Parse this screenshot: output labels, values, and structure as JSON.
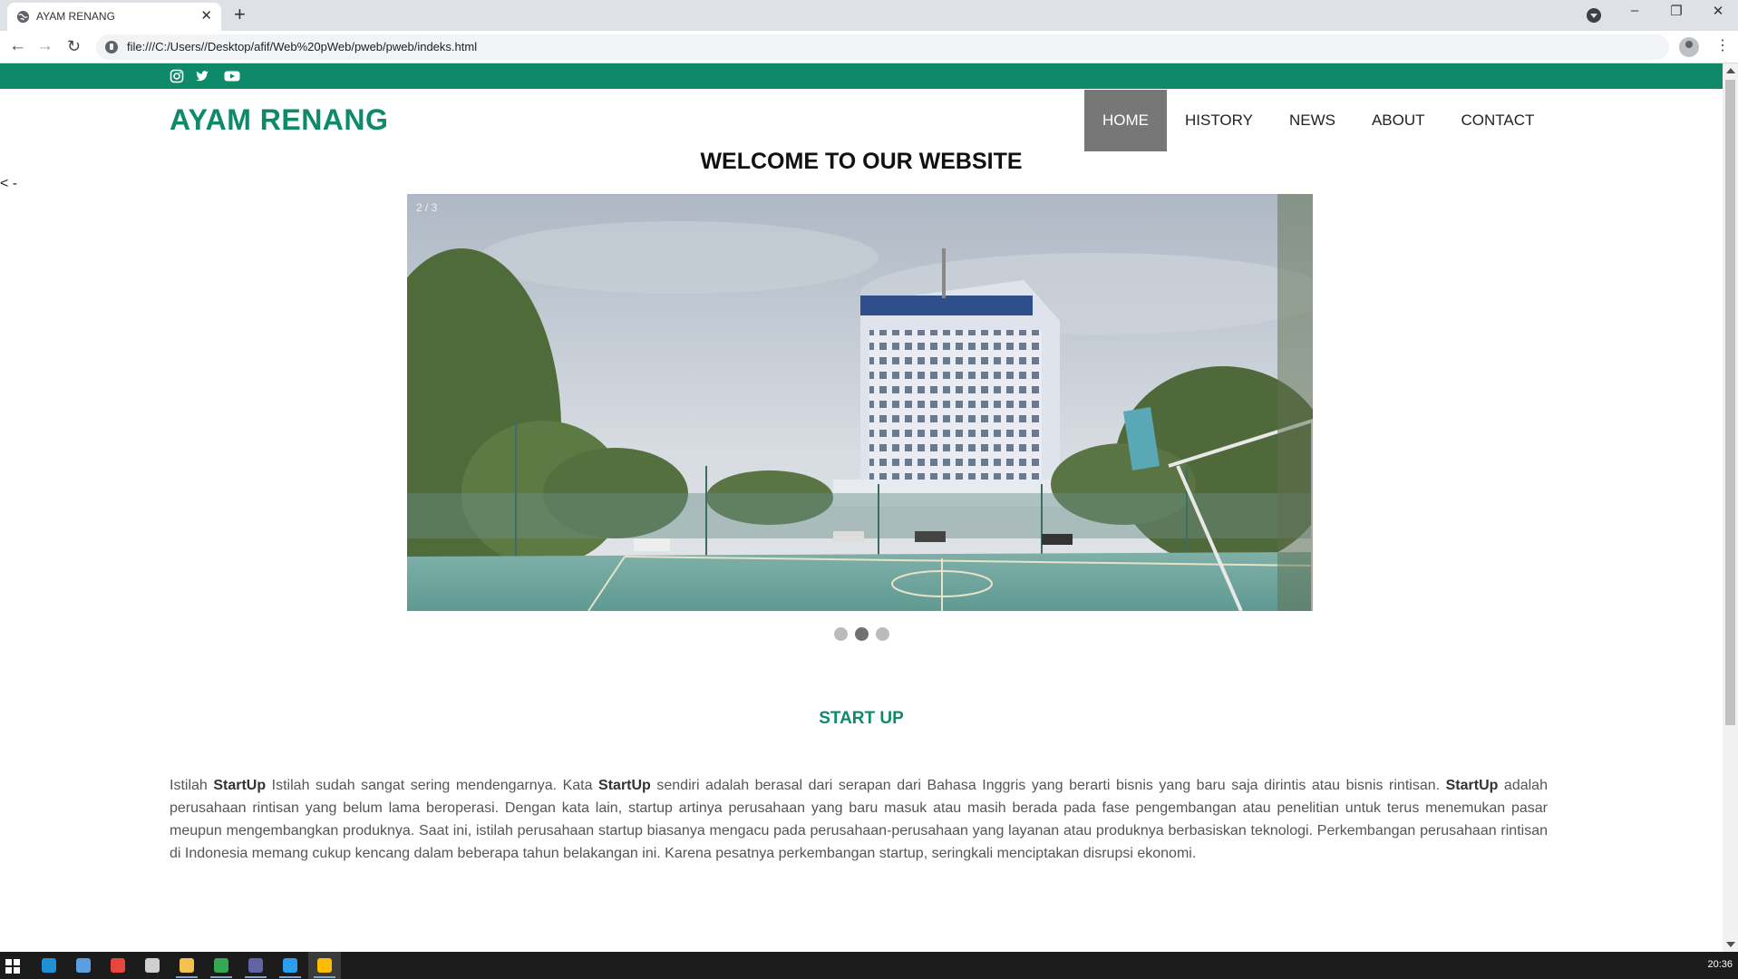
{
  "browser": {
    "tab_title": "AYAM RENANG",
    "url": "file:///C:/Users//Desktop/afif/Web%20pWeb/pweb/pweb/indeks.html",
    "new_tab": "+",
    "close_tab": "✕"
  },
  "site": {
    "social": [
      "instagram-icon",
      "twitter-icon",
      "youtube-icon"
    ],
    "brand": "AYAM RENANG",
    "nav": [
      {
        "label": "HOME",
        "active": true
      },
      {
        "label": "HISTORY",
        "active": false
      },
      {
        "label": "NEWS",
        "active": false
      },
      {
        "label": "ABOUT",
        "active": false
      },
      {
        "label": "CONTACT",
        "active": false
      }
    ],
    "left_arrow": "< -",
    "welcome": "WELCOME TO OUR WEBSITE",
    "slideshow": {
      "counter": "2 / 3",
      "total": 3,
      "current": 2
    },
    "section_title": "START UP",
    "paragraph": [
      {
        "t": "Istilah "
      },
      {
        "t": "StartUp",
        "b": true
      },
      {
        "t": " Istilah sudah sangat sering mendengarnya. Kata "
      },
      {
        "t": "StartUp",
        "b": true
      },
      {
        "t": " sendiri adalah berasal dari serapan dari Bahasa Inggris yang berarti bisnis yang baru saja dirintis atau bisnis rintisan. "
      },
      {
        "t": "StartUp",
        "b": true
      },
      {
        "t": " adalah perusahaan rintisan yang belum lama beroperasi. Dengan kata lain, startup artinya perusahaan yang baru masuk atau masih berada pada fase pengembangan atau penelitian untuk terus menemukan pasar meupun mengembangkan produknya. Saat ini, istilah perusahaan startup biasanya mengacu pada perusahaan-perusahaan yang layanan atau produknya berbasiskan teknologi. Perkembangan perusahaan rintisan di Indonesia memang cukup kencang dalam beberapa tahun belakangan ini. Karena pesatnya perkembangan startup, seringkali menciptakan disrupsi ekonomi."
      }
    ]
  },
  "taskbar": {
    "clock": "20:36",
    "apps": [
      {
        "name": "edge-icon",
        "color": "#1f8fd6",
        "running": false,
        "active": false
      },
      {
        "name": "desktop-icon",
        "color": "#5aa0e0",
        "running": false,
        "active": false
      },
      {
        "name": "chrome-icon",
        "color": "#e8453c",
        "running": false,
        "active": false
      },
      {
        "name": "store-icon",
        "color": "#cfcfcf",
        "running": false,
        "active": false
      },
      {
        "name": "file-explorer-icon",
        "color": "#f2c14e",
        "running": true,
        "active": false
      },
      {
        "name": "chrome-alt-icon",
        "color": "#34a853",
        "running": true,
        "active": false
      },
      {
        "name": "teams-icon",
        "color": "#6264a7",
        "running": true,
        "active": false
      },
      {
        "name": "vscode-icon",
        "color": "#2c9ef0",
        "running": true,
        "active": false
      },
      {
        "name": "chrome-active-icon",
        "color": "#fbbc05",
        "running": true,
        "active": true
      }
    ]
  }
}
